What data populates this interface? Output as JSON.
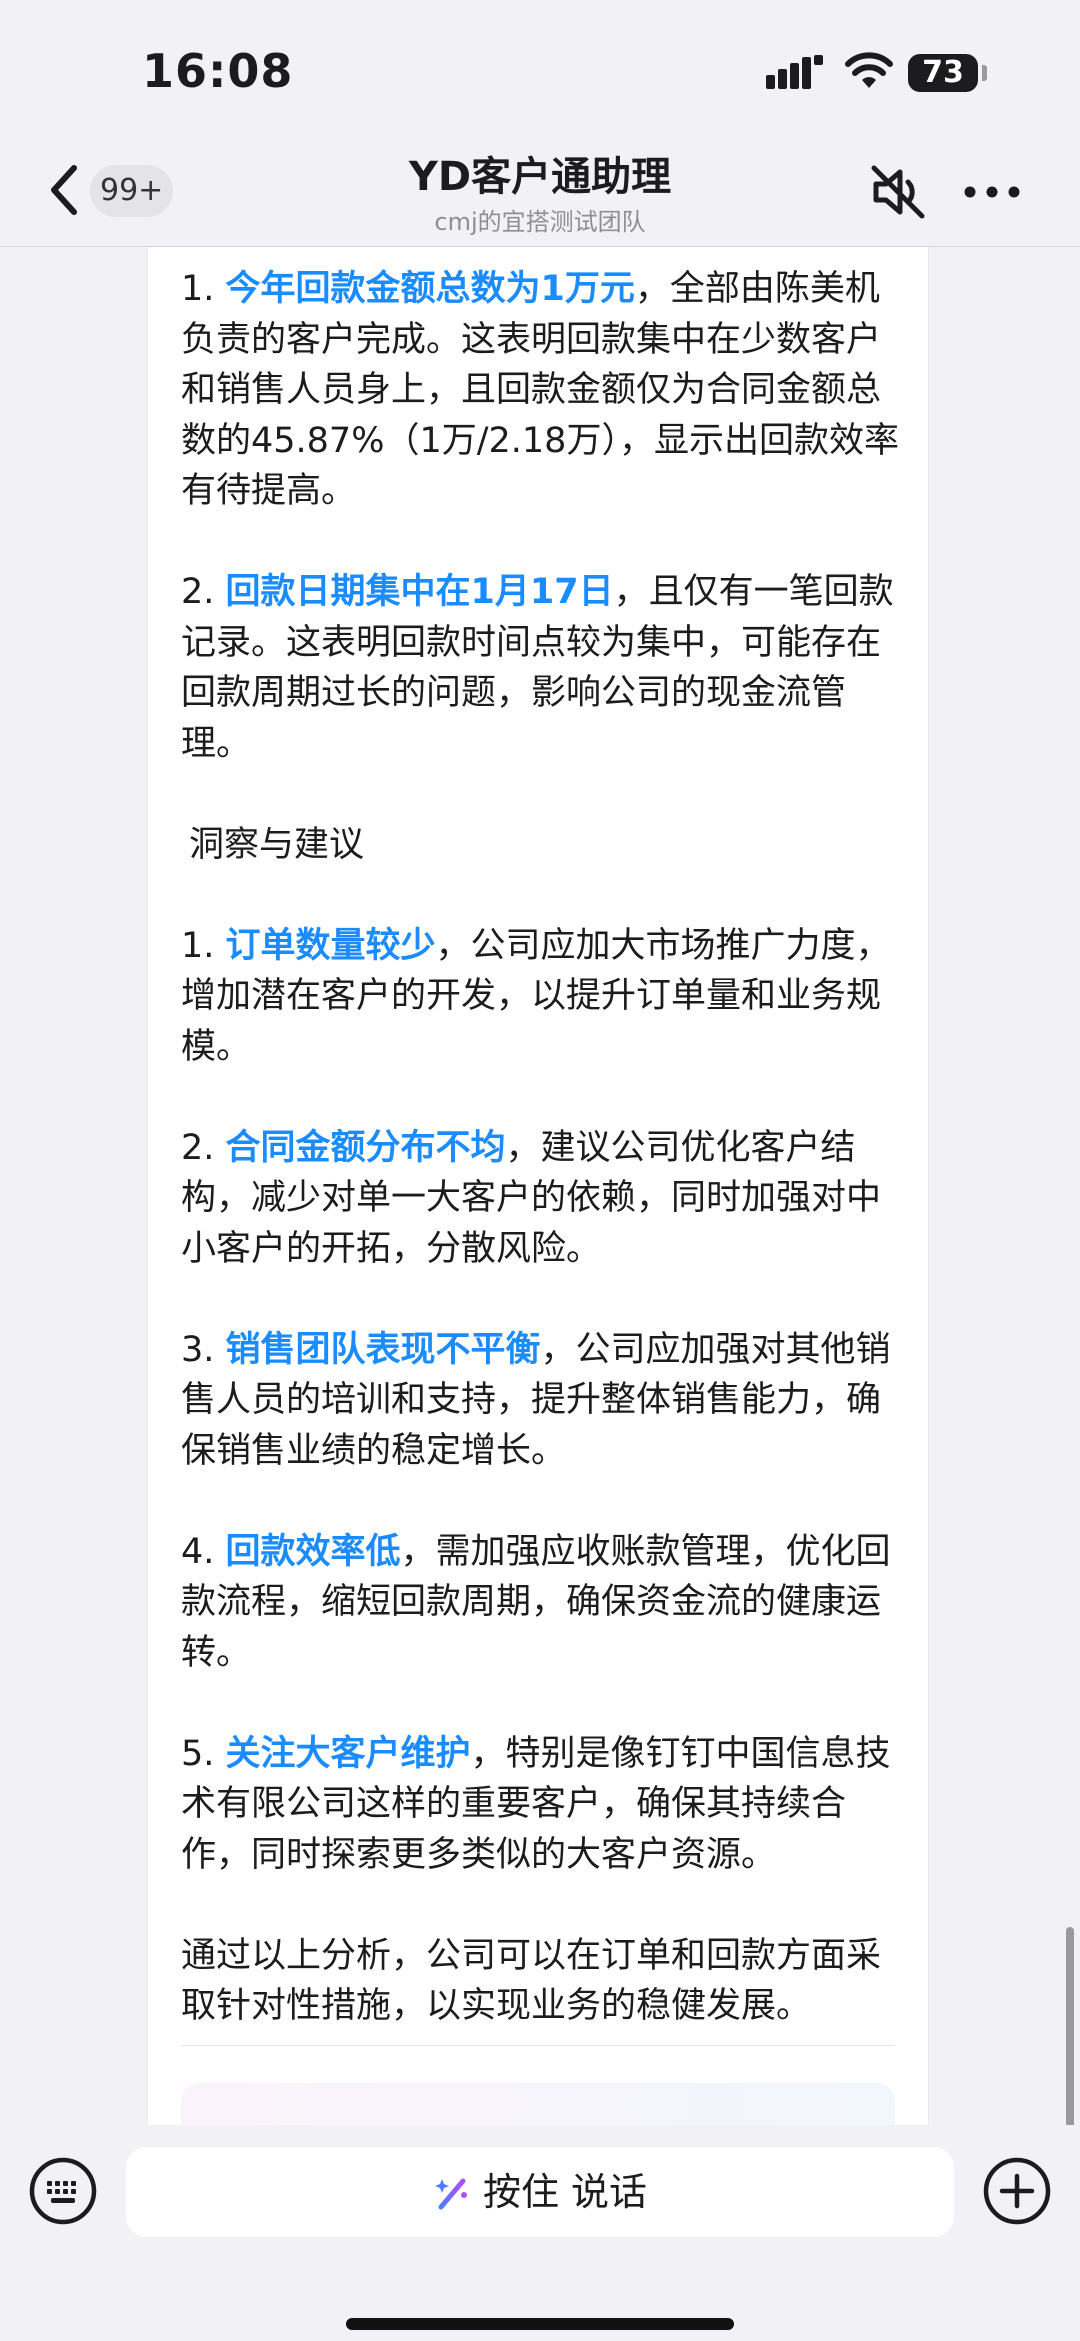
{
  "status_bar": {
    "time": "16:08",
    "battery": "73"
  },
  "nav": {
    "badge": "99+",
    "title": "YD客户通助理",
    "subtitle": "cmj的宜搭测试团队"
  },
  "message": {
    "p1": {
      "num": "1. ",
      "hl": "今年回款金额总数为1万元",
      "rest": "，全部由陈美机负责的客户完成。这表明回款集中在少数客户和销售人员身上，且回款金额仅为合同金额总数的45.87%（1万/2.18万），显示出回款效率有待提高。"
    },
    "p2": {
      "num": "2. ",
      "hl": "回款日期集中在1月17日",
      "rest": "，且仅有一笔回款记录。这表明回款时间点较为集中，可能存在回款周期过长的问题，影响公司的现金流管理。"
    },
    "heading": "洞察与建议",
    "s1": {
      "num": "1. ",
      "hl": "订单数量较少",
      "rest": "，公司应加大市场推广力度，增加潜在客户的开发，以提升订单量和业务规模。"
    },
    "s2": {
      "num": "2. ",
      "hl": "合同金额分布不均",
      "rest": "，建议公司优化客户结构，减少对单一大客户的依赖，同时加强对中小客户的开拓，分散风险。"
    },
    "s3": {
      "num": "3. ",
      "hl": "销售团队表现不平衡",
      "rest": "，公司应加强对其他销售人员的培训和支持，提升整体销售能力，确保销售业绩的稳定增长。"
    },
    "s4": {
      "num": "4. ",
      "hl": "回款效率低",
      "rest": "，需加强应收账款管理，优化回款流程，缩短回款周期，确保资金流的健康运转。"
    },
    "s5": {
      "num": "5. ",
      "hl": "关注大客户维护",
      "rest": "，特别是像钉钉中国信息技术有限公司这样的重要客户，确保其持续合作，同时探索更多类似的大客户资源。"
    },
    "conclusion": "通过以上分析，公司可以在订单和回款方面采取针对性措施，以实现业务的稳健发展。"
  },
  "input_bar": {
    "voice_label": "按住 说话"
  },
  "colors": {
    "highlight": "#1a8cff",
    "background": "#f2f2f6"
  },
  "icons": {
    "back": "chevron-left-icon",
    "mute": "speaker-muted-icon",
    "more": "more-dots-icon",
    "keyboard": "keyboard-icon",
    "voice": "sparkle-pen-icon",
    "plus": "plus-circle-icon"
  }
}
